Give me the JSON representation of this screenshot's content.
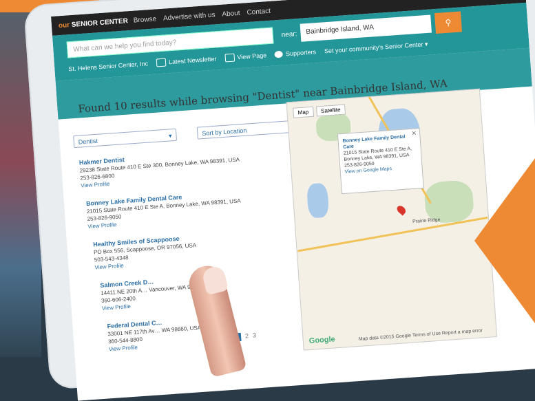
{
  "header": {
    "logo_prefix": "our",
    "logo_main": "SENIOR CENTER",
    "nav": [
      "Browse",
      "Advertise with us",
      "About",
      "Contact"
    ]
  },
  "search": {
    "placeholder": "What can we help you find today?",
    "near_label": "near:",
    "location_value": "Bainbridge Island, WA",
    "go_icon": "search-icon"
  },
  "toolbar": {
    "center_name": "St. Helens Senior Center, Inc",
    "newsletter": "Latest Newsletter",
    "view_page": "View Page",
    "supporters": "Supporters",
    "select_senior_center": "Set your community's Senior Center ▾"
  },
  "results": {
    "title": "Found 10 results while browsing \"Dentist\" near Bainbridge Island, WA",
    "category_filter": "Dentist",
    "sort_filter": "Sort by Location",
    "items": [
      {
        "name": "Hakmer Dentist",
        "address": "29238 State Route 410 E Ste 300, Bonney Lake, WA 98391, USA",
        "phone": "253-826-6800",
        "link": "View Profile"
      },
      {
        "name": "Bonney Lake Family Dental Care",
        "address": "21015 State Route 410 E Ste A, Bonney Lake, WA 98391, USA",
        "phone": "253-826-9050",
        "link": "View Profile"
      },
      {
        "name": "Healthy Smiles of Scappoose",
        "address": "PO Box 556, Scappoose, OR 97056, USA",
        "phone": "503-543-4348",
        "link": "View Profile"
      },
      {
        "name": "Salmon Creek D…",
        "address": "14411 NE 20th A… Vancouver, WA 98686, USA",
        "phone": "360-606-2400",
        "link": "View Profile"
      },
      {
        "name": "Federal Dental C…",
        "address": "33001 NE 117th Av… WA 98660, USA",
        "phone": "360-544-8800",
        "link": "View Profile"
      }
    ],
    "pages": [
      "1",
      "2",
      "3"
    ]
  },
  "map": {
    "tabs": [
      "Map",
      "Satellite"
    ],
    "popup_name": "Bonney Lake Family Dental Care",
    "popup_address": "21015 State Route 410 E Ste A, Bonney Lake, WA 98391, USA",
    "popup_phone": "253-826-9050",
    "popup_link": "View on Google Maps",
    "close_icon": "close-icon",
    "brand": "Google",
    "footer": "Map data ©2015 Google    Terms of Use   Report a map error",
    "place_label": "Prairie Ridge"
  },
  "colors": {
    "accent": "#ee8a34",
    "teal": "#23969a",
    "link": "#2a6ea6"
  }
}
